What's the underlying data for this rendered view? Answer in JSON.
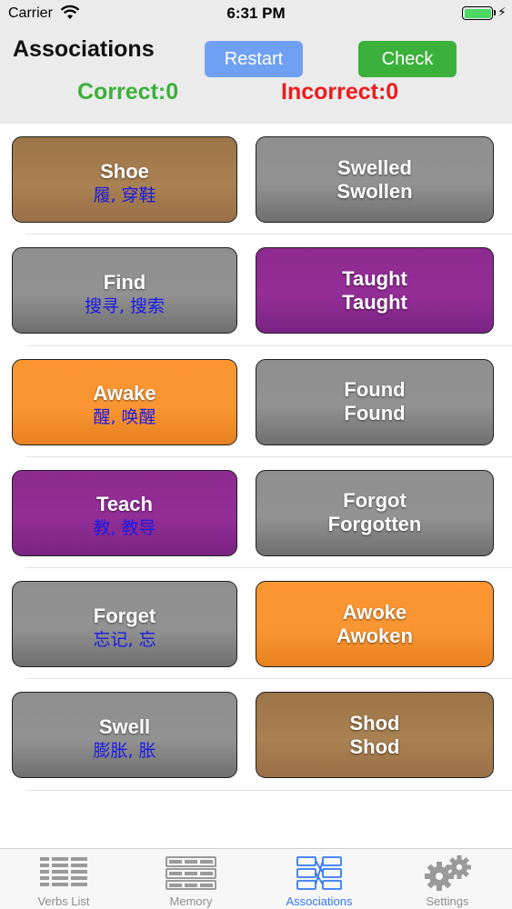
{
  "status_bar": {
    "carrier": "Carrier",
    "time": "6:31 PM"
  },
  "header": {
    "title": "Associations",
    "restart_label": "Restart",
    "check_label": "Check",
    "correct_text": "Correct:0",
    "incorrect_text": "Incorrect:0"
  },
  "colors": {
    "brown": "#a57c50",
    "gray": "#8c8c8c",
    "purple": "#8f2b92",
    "orange": "#f8952f",
    "correct": "#3bb03b",
    "incorrect": "#ee1c1c",
    "chinese_text": "#1a1ae6",
    "tab_active": "#3478f6"
  },
  "rows": [
    {
      "left": {
        "word": "Shoe",
        "translation": "履, 穿鞋",
        "color": "brown"
      },
      "right": {
        "line1": "Swelled",
        "line2": "Swollen",
        "color": "gray"
      }
    },
    {
      "left": {
        "word": "Find",
        "translation": "搜寻, 搜索",
        "color": "gray"
      },
      "right": {
        "line1": "Taught",
        "line2": "Taught",
        "color": "purple"
      }
    },
    {
      "left": {
        "word": "Awake",
        "translation": "醒, 唤醒",
        "color": "orange"
      },
      "right": {
        "line1": "Found",
        "line2": "Found",
        "color": "gray"
      }
    },
    {
      "left": {
        "word": "Teach",
        "translation": "教, 教导",
        "color": "purple"
      },
      "right": {
        "line1": "Forgot",
        "line2": "Forgotten",
        "color": "gray"
      }
    },
    {
      "left": {
        "word": "Forget",
        "translation": "忘记, 忘",
        "color": "gray"
      },
      "right": {
        "line1": "Awoke",
        "line2": "Awoken",
        "color": "orange"
      }
    },
    {
      "left": {
        "word": "Swell",
        "translation": "膨胀, 胀",
        "color": "gray"
      },
      "right": {
        "line1": "Shod",
        "line2": "Shod",
        "color": "brown"
      }
    }
  ],
  "tabs": [
    {
      "label": "Verbs List",
      "icon": "list-icon",
      "active": false
    },
    {
      "label": "Memory",
      "icon": "memory-icon",
      "active": false
    },
    {
      "label": "Associations",
      "icon": "associations-icon",
      "active": true
    },
    {
      "label": "Settings",
      "icon": "gears-icon",
      "active": false
    }
  ]
}
